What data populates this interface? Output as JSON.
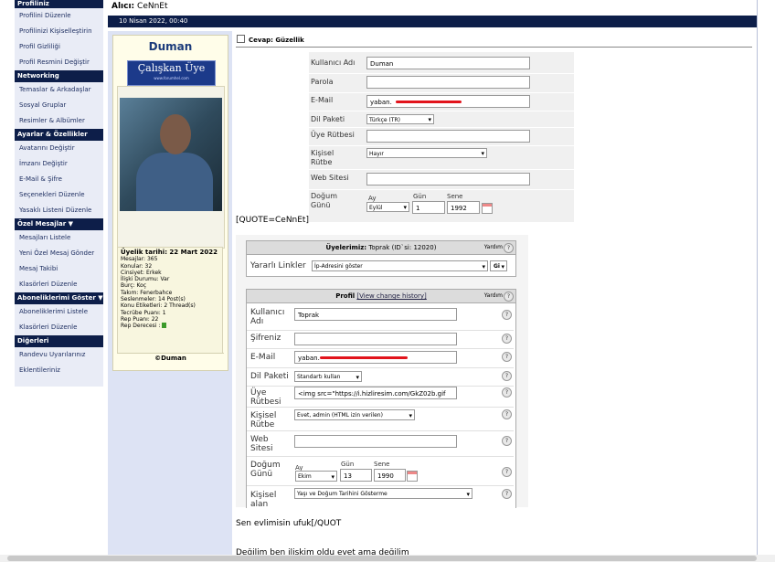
{
  "sidebar": {
    "sections": [
      {
        "title": "Profiliniz",
        "items": [
          "Profilini Düzenle",
          "Profilinizi Kişiselleştirin",
          "Profil Gizliliği",
          "Profil Resmini Değiştir"
        ]
      },
      {
        "title": "Networking",
        "items": [
          "Temaslar & Arkadaşlar",
          "Sosyal Gruplar",
          "Resimler & Albümler"
        ]
      },
      {
        "title": "Ayarlar & Özellikler",
        "items": [
          "Avatarını Değiştir",
          "İmzanı Değiştir",
          "E-Mail & Şifre",
          "Seçenekleri Düzenle",
          "Yasaklı Listeni Düzenle"
        ]
      },
      {
        "title": "Özel Mesajlar",
        "items": [
          "Mesajları Listele",
          "Yeni Özel Mesaj Gönder",
          "Mesaj Takibi",
          "Klasörleri Düzenle"
        ]
      },
      {
        "title": "Aboneliklerimi Göster",
        "items": [
          "Aboneliklerimi Listele",
          "Klasörleri Düzenle"
        ]
      },
      {
        "title": "Diğerleri",
        "items": [
          "Randevu Uyarılarınız",
          "Eklentileriniz"
        ]
      }
    ]
  },
  "header": {
    "recipient_label": "Alıcı:",
    "recipient": "CeNnEt",
    "date": "10 Nisan 2022, 00:40"
  },
  "user": {
    "name": "Duman",
    "badge_title": "Çalışkan Üye",
    "badge_sub": "www.forumhel.com",
    "stats": [
      "Üyelik tarihi: 22 Mart 2022",
      "Mesajlar: 365",
      "Konular: 32",
      "Cinsiyet: Erkek",
      "İlişki Durumu: Var",
      "Burç: Koç",
      "Takım: Fenerbahce",
      "Seslenmeler: 14 Post(s)",
      "Konu Etiketleri: 2 Thread(s)",
      "Tecrübe Puanı: 1",
      "Rep Puanı: 22",
      "Rep Derecesi :"
    ],
    "footer": "©Duman"
  },
  "message": {
    "subject": "Cevap: Güzellik",
    "quote_open": "[QUOTE=CeNnEt]",
    "line1": "Sen evlimisin ufuk[/QUOT",
    "line2": "Değilim ben iliskim oldu evet ama değilim"
  },
  "form1": {
    "fields": [
      {
        "label": "Kullanıcı Adı",
        "value": "Duman"
      },
      {
        "label": "Parola",
        "value": ""
      },
      {
        "label": "E-Mail",
        "value": "yaban."
      },
      {
        "label": "Dil Paketi",
        "value": "Türkçe (TR)"
      },
      {
        "label": "Üye Rütbesi",
        "value": ""
      },
      {
        "label": "Kişisel Rütbe",
        "value": "Hayır"
      },
      {
        "label": "Web Sitesi",
        "value": ""
      },
      {
        "label": "Doğum Günü",
        "value": ""
      }
    ],
    "birth": {
      "ay_label": "Ay",
      "gun_label": "Gün",
      "sene_label": "Sene",
      "ay": "Eylül",
      "gun": "1",
      "sene": "1992"
    }
  },
  "form2": {
    "members_title": "Üyelerimiz:",
    "members_value": "Toprak (ID`si: 12020)",
    "help": "Yardım",
    "useful_links_label": "Yararlı Linkler",
    "useful_links_value": "İp-Adresini göster",
    "go": "Git",
    "profile_title": "Profil",
    "profile_history": "[View change history]",
    "fields": [
      {
        "label": "Kullanıcı Adı",
        "value": "Toprak"
      },
      {
        "label": "Şifreniz",
        "value": ""
      },
      {
        "label": "E-Mail",
        "value": "yaban."
      },
      {
        "label": "Dil Paketi",
        "value": "Standartı kullan"
      },
      {
        "label": "Üye Rütbesi",
        "value": "<img src=\"https://i.hizliresim.com/GkZ02b.gif"
      },
      {
        "label": "Kişisel Rütbe",
        "value": "Evet, admin (HTML izin verilen)"
      },
      {
        "label": "Web Sitesi",
        "value": ""
      },
      {
        "label": "Doğum Günü",
        "value": ""
      },
      {
        "label": "Kişisel alan",
        "value": "Yaşı ve Doğum Tarihini Gösterme"
      }
    ],
    "birth": {
      "ay_label": "Ay",
      "gun_label": "Gün",
      "sene_label": "Sene",
      "ay": "Ekim",
      "gun": "13",
      "sene": "1990"
    }
  },
  "colors": {
    "navy": "#0d1e49",
    "sidebar_bg": "#e9ecf6",
    "user_bg": "#fffde9",
    "redact": "#e2141c"
  }
}
